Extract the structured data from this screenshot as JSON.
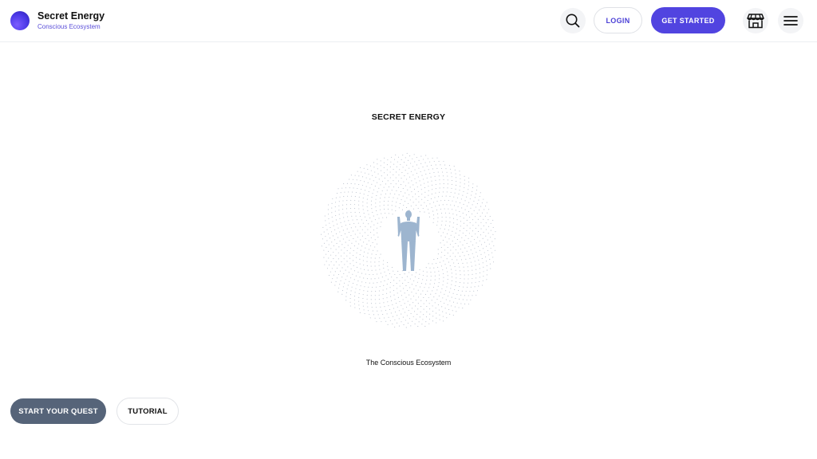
{
  "header": {
    "brand_name": "Secret Energy",
    "brand_tagline": "Conscious Ecosystem",
    "search_icon": "search-icon",
    "login_label": "LOGIN",
    "get_started_label": "GET STARTED",
    "store_icon": "store-icon",
    "menu_icon": "hamburger-menu-icon"
  },
  "hero": {
    "title": "SECRET ENERGY",
    "subtitle": "The Conscious Ecosystem",
    "figure_icon": "human-figure-icon"
  },
  "actions": {
    "start_quest_label": "START YOUR QUEST",
    "tutorial_label": "TUTORIAL"
  },
  "colors": {
    "accent": "#5144e0",
    "quest_button": "#566479",
    "figure": "#9db5cf",
    "dots": "#b9c0cc"
  }
}
